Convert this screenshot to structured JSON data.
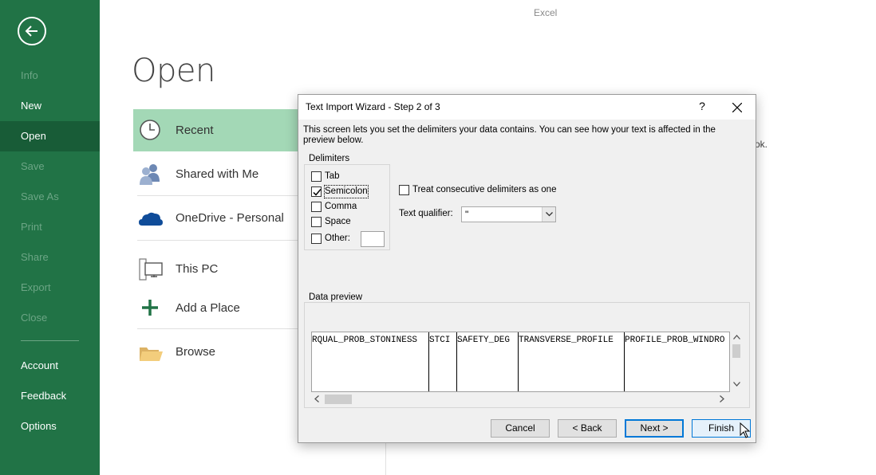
{
  "window": {
    "app_title": "Excel"
  },
  "sidebar": {
    "items": [
      {
        "label": "Info",
        "disabled": true
      },
      {
        "label": "New",
        "disabled": false
      },
      {
        "label": "Open",
        "disabled": false,
        "active": true
      },
      {
        "label": "Save",
        "disabled": true
      },
      {
        "label": "Save As",
        "disabled": true
      },
      {
        "label": "Print",
        "disabled": true
      },
      {
        "label": "Share",
        "disabled": true
      },
      {
        "label": "Export",
        "disabled": true
      },
      {
        "label": "Close",
        "disabled": true
      },
      {
        "label": "Account",
        "disabled": false
      },
      {
        "label": "Feedback",
        "disabled": false
      },
      {
        "label": "Options",
        "disabled": false
      }
    ]
  },
  "open_page": {
    "title": "Open",
    "places": [
      {
        "label": "Recent",
        "icon": "clock-icon",
        "selected": true
      },
      {
        "label": "Shared with Me",
        "icon": "people-icon"
      },
      {
        "label": "OneDrive - Personal",
        "icon": "onedrive-cloud-icon"
      },
      {
        "label": "This PC",
        "icon": "computer-icon"
      },
      {
        "label": "Add a Place",
        "icon": "plus-icon"
      },
      {
        "label": "Browse",
        "icon": "folder-icon"
      }
    ],
    "background_text_fragment": "ok."
  },
  "dialog": {
    "title": "Text Import Wizard - Step 2 of 3",
    "help": "?",
    "description": "This screen lets you set the delimiters your data contains.  You can see how your text is affected in the preview below.",
    "delimiters": {
      "group_label": "Delimiters",
      "options": [
        {
          "label": "Tab",
          "checked": false
        },
        {
          "label": "Semicolon",
          "checked": true
        },
        {
          "label": "Comma",
          "checked": false
        },
        {
          "label": "Space",
          "checked": false
        },
        {
          "label": "Other:",
          "checked": false
        }
      ],
      "other_value": ""
    },
    "treat_consecutive": {
      "label": "Treat consecutive delimiters as one",
      "checked": false
    },
    "text_qualifier": {
      "label": "Text qualifier:",
      "value": "\""
    },
    "data_preview": {
      "group_label": "Data preview",
      "columns": [
        "RQUAL_PROB_STONINESS",
        "STCI",
        "SAFETY_DEG",
        "TRANSVERSE_PROFILE",
        "PROFILE_PROB_WINDRO"
      ]
    },
    "buttons": {
      "cancel": "Cancel",
      "back": "< Back",
      "next": "Next >",
      "finish": "Finish"
    }
  },
  "colors": {
    "sidebar_bg": "#217346",
    "sidebar_active": "#185c37",
    "selected_place": "#a3d8b6",
    "accent_blue": "#0078d7"
  }
}
